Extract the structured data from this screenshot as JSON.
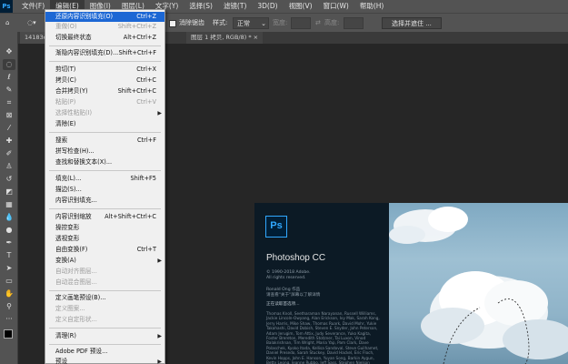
{
  "menubar": {
    "logo": "Ps",
    "items": [
      "文件(F)",
      "编辑(E)",
      "图像(I)",
      "图层(L)",
      "文字(Y)",
      "选择(S)",
      "滤镜(T)",
      "3D(D)",
      "视图(V)",
      "窗口(W)",
      "帮助(H)"
    ]
  },
  "options": {
    "feather_label": "消除锯齿",
    "style_label": "样式:",
    "style_value": "正常",
    "width_label": "宽度:",
    "height_label": "高度:",
    "select_mask_button": "选择并遮住 ..."
  },
  "tabs": {
    "left": "14183c...",
    "right": "图层 1 拷贝, RGB/8) *"
  },
  "menu": {
    "items": [
      {
        "label": "还原内容识别填充(O)",
        "shortcut": "Ctrl+Z"
      },
      {
        "label": "重做(O)",
        "shortcut": "Shift+Ctrl+Z"
      },
      {
        "label": "切换最终状态",
        "shortcut": "Alt+Ctrl+Z"
      },
      {
        "label": "渐隐内容识别填充(D)...",
        "shortcut": "Shift+Ctrl+F"
      },
      {
        "label": "剪切(T)",
        "shortcut": "Ctrl+X"
      },
      {
        "label": "拷贝(C)",
        "shortcut": "Ctrl+C"
      },
      {
        "label": "合并拷贝(Y)",
        "shortcut": "Shift+Ctrl+C"
      },
      {
        "label": "粘贴(P)",
        "shortcut": "Ctrl+V"
      },
      {
        "label": "选择性粘贴(I)",
        "shortcut": ""
      },
      {
        "label": "清除(E)",
        "shortcut": ""
      },
      {
        "label": "搜索",
        "shortcut": "Ctrl+F"
      },
      {
        "label": "拼写检查(H)...",
        "shortcut": ""
      },
      {
        "label": "查找和替换文本(X)...",
        "shortcut": ""
      },
      {
        "label": "填充(L)...",
        "shortcut": "Shift+F5"
      },
      {
        "label": "描边(S)...",
        "shortcut": ""
      },
      {
        "label": "内容识别填充...",
        "shortcut": ""
      },
      {
        "label": "内容识别缩放",
        "shortcut": "Alt+Shift+Ctrl+C"
      },
      {
        "label": "操控变形",
        "shortcut": ""
      },
      {
        "label": "透视变形",
        "shortcut": ""
      },
      {
        "label": "自由变换(F)",
        "shortcut": "Ctrl+T"
      },
      {
        "label": "变换(A)",
        "shortcut": ""
      },
      {
        "label": "自动对齐图层...",
        "shortcut": ""
      },
      {
        "label": "自动混合图层...",
        "shortcut": ""
      },
      {
        "label": "定义画笔预设(B)...",
        "shortcut": ""
      },
      {
        "label": "定义图案...",
        "shortcut": ""
      },
      {
        "label": "定义自定形状...",
        "shortcut": ""
      },
      {
        "label": "清理(R)",
        "shortcut": ""
      },
      {
        "label": "Adobe PDF 预设...",
        "shortcut": ""
      },
      {
        "label": "预设",
        "shortcut": ""
      },
      {
        "label": "远程连接...",
        "shortcut": ""
      }
    ]
  },
  "splash": {
    "logo": "Ps",
    "title": "Photoshop CC",
    "copyright": "© 1990-2018 Adobe.\nAll rights reserved.",
    "credit": "Ronald Ong 作品\n请查看\"关于\"屏幕以了解详情",
    "status": "正在读取首选项...",
    "names": "Thomas Knoll, Seetharaman Narayanan, Russell Williams, Jackie Lincoln-Owyang, Alan Erickson, Ivy Mak, Sarah Kong, Jerry Harris, Mike Shaw, Thomas Ruark, David Mohr, Yukie Takahashi, David Dobish, Steven E. Snyder, John Peterson, Adam Jerugim, Tom Attix, Judy Severance, Yuko Kagita, Foster Brereton, Meredith Stotzner, Tai Luxon, Vinod Balakrishnan, Tim Wright, Maria Yap, Pam Clark, Dave Polaschek, Kyoko Itoda, Kellisa Sandoval, Steve Guilhamet, Daniel Presedo, Sarah Stuckey, David Hackel, Eric Floch, Kevin Hopps, John E. Hanson, Yuyan Song, Barkin Aygun, Betty Leong, Jeanne Rubbo, Jeff Sass, Stephen Nielson"
  }
}
